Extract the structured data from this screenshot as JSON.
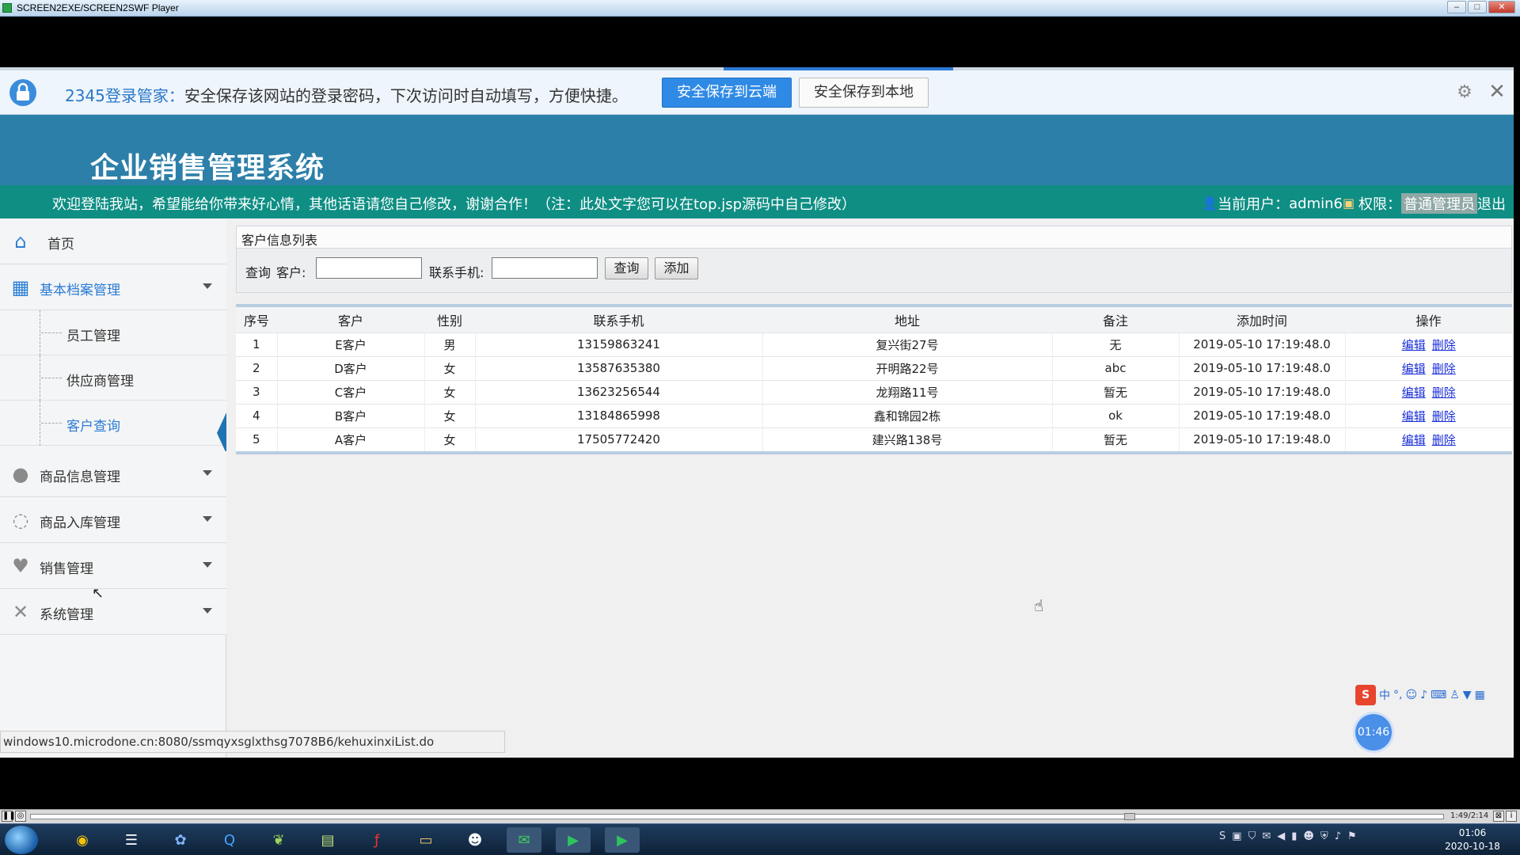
{
  "player": {
    "title": "SCREEN2EXE/SCREEN2SWF Player",
    "time_display": "1:49/2:14",
    "progress_fraction": 0.78
  },
  "password_bar": {
    "brand": "2345登录管家：",
    "message": "安全保存该网站的登录密码，下次访问时自动填写，方便快捷。",
    "save_cloud_label": "安全保存到云端",
    "save_local_label": "安全保存到本地"
  },
  "header": {
    "app_title": "企业销售管理系统",
    "welcome_text": "欢迎登陆我站，希望能给你带来好心情，其他话语请您自己修改，谢谢合作！（注：此处文字您可以在top.jsp源码中自己修改）",
    "current_user_label": "当前用户：",
    "current_user": "admin6",
    "permission_label": "权限：",
    "role": "普通管理员",
    "logout_label": "退出"
  },
  "sidebar": {
    "home": "首页",
    "basic_archive": "基本档案管理",
    "employee_mgmt": "员工管理",
    "supplier_mgmt": "供应商管理",
    "customer_query": "客户查询",
    "product_info": "商品信息管理",
    "product_inbound": "商品入库管理",
    "sales_mgmt": "销售管理",
    "system_mgmt": "系统管理"
  },
  "content": {
    "panel_title": "客户信息列表",
    "query_label": "查询",
    "customer_label": "客户:",
    "customer_value": "",
    "phone_label": "联系手机:",
    "phone_value": "",
    "search_button": "查询",
    "add_button": "添加",
    "columns": [
      "序号",
      "客户",
      "性别",
      "联系手机",
      "地址",
      "备注",
      "添加时间",
      "操作"
    ],
    "edit_label": "编辑",
    "delete_label": "删除",
    "rows": [
      {
        "no": "1",
        "customer": "E客户",
        "gender": "男",
        "phone": "13159863241",
        "address": "复兴街27号",
        "note": "无",
        "time": "2019-05-10 17:19:48.0"
      },
      {
        "no": "2",
        "customer": "D客户",
        "gender": "女",
        "phone": "13587635380",
        "address": "开明路22号",
        "note": "abc",
        "time": "2019-05-10 17:19:48.0"
      },
      {
        "no": "3",
        "customer": "C客户",
        "gender": "女",
        "phone": "13623256544",
        "address": "龙翔路11号",
        "note": "暂无",
        "time": "2019-05-10 17:19:48.0"
      },
      {
        "no": "4",
        "customer": "B客户",
        "gender": "女",
        "phone": "13184865998",
        "address": "鑫和锦园2栋",
        "note": "ok",
        "time": "2019-05-10 17:19:48.0"
      },
      {
        "no": "5",
        "customer": "A客户",
        "gender": "女",
        "phone": "17505772420",
        "address": "建兴路138号",
        "note": "暂无",
        "time": "2019-05-10 17:19:48.0"
      }
    ]
  },
  "status_url": "windows10.microdone.cn:8080/ssmqyxsglxthsg7078B6/kehuxinxiList.do",
  "ime": {
    "logo": "S",
    "mode": "中"
  },
  "timer_bubble": "01:46",
  "clock": {
    "time": "01:06",
    "date": "2020-10-18"
  },
  "colors": {
    "header_blue": "#2c7fa8",
    "welcome_teal": "#0f8e84",
    "accent": "#2f8ae6"
  }
}
